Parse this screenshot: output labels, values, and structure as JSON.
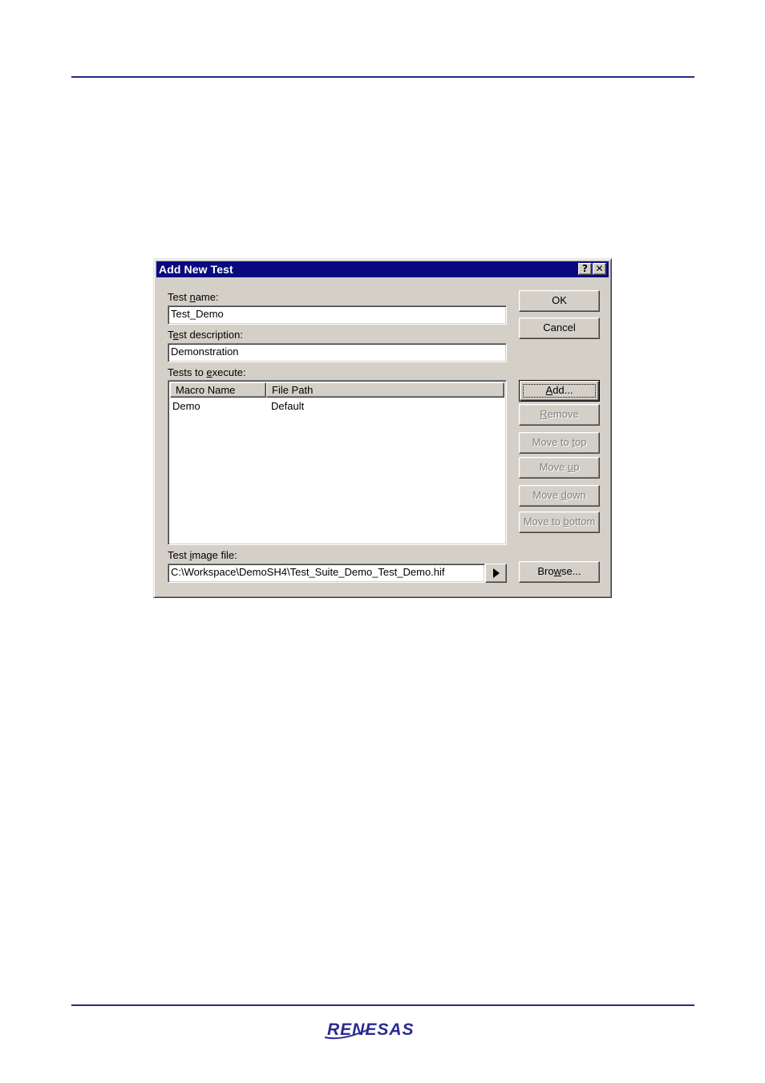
{
  "dialog": {
    "title": "Add New Test",
    "help_glyph": "?",
    "close_glyph": "✕"
  },
  "labels": {
    "test_name": {
      "pre": "Test ",
      "key": "n",
      "post": "ame:"
    },
    "test_description": {
      "pre": "T",
      "key": "e",
      "post": "st description:"
    },
    "tests_to_execute": {
      "pre": "Tests to ",
      "key": "e",
      "post": "xecute:"
    },
    "test_image_file": {
      "pre": "Test ",
      "key": "i",
      "post": "mage file:"
    }
  },
  "fields": {
    "test_name": "Test_Demo",
    "test_description": "Demonstration",
    "test_image_file": "C:\\Workspace\\DemoSH4\\Test_Suite_Demo_Test_Demo.hif"
  },
  "list": {
    "columns": [
      "Macro Name",
      "File Path"
    ],
    "rows": [
      {
        "macro_name": "Demo",
        "file_path": "Default"
      }
    ]
  },
  "buttons": {
    "ok": "OK",
    "cancel": "Cancel",
    "add": {
      "key": "A",
      "post": "dd..."
    },
    "remove": {
      "key": "R",
      "post": "emove"
    },
    "move_to_top": {
      "pre": "Move to ",
      "key": "t",
      "post": "op"
    },
    "move_up": {
      "pre": "Move ",
      "key": "u",
      "post": "p"
    },
    "move_down": {
      "pre": "Move ",
      "key": "d",
      "post": "own"
    },
    "move_to_bottom": {
      "pre": "Move to ",
      "key": "b",
      "post": "ottom"
    },
    "browse": {
      "pre": "Bro",
      "key": "w",
      "post": "se..."
    }
  },
  "footer": {
    "logo_text": "RENESAS"
  },
  "colors": {
    "rule": "#28288c",
    "titlebar": "#0a0a80",
    "dialog_face": "#d4d0c8",
    "logo": "#2b2b8f"
  }
}
